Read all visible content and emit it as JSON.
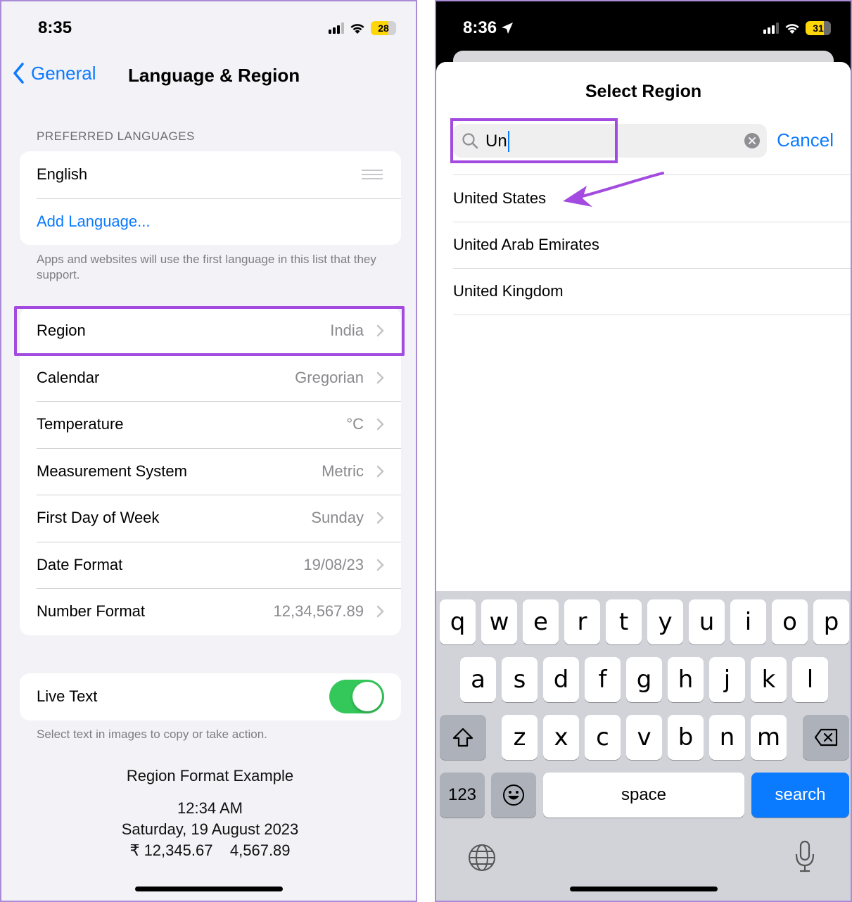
{
  "left_screen": {
    "status": {
      "time": "8:35",
      "battery": "28"
    },
    "nav": {
      "back_label": "General",
      "title": "Language & Region"
    },
    "preferred_languages": {
      "header": "PREFERRED LANGUAGES",
      "language": "English",
      "add_label": "Add Language...",
      "footer": "Apps and websites will use the first language in this list that they support."
    },
    "settings": [
      {
        "label": "Region",
        "value": "India"
      },
      {
        "label": "Calendar",
        "value": "Gregorian"
      },
      {
        "label": "Temperature",
        "value": "°C"
      },
      {
        "label": "Measurement System",
        "value": "Metric"
      },
      {
        "label": "First Day of Week",
        "value": "Sunday"
      },
      {
        "label": "Date Format",
        "value": "19/08/23"
      },
      {
        "label": "Number Format",
        "value": "12,34,567.89"
      }
    ],
    "live_text": {
      "label": "Live Text",
      "enabled": true,
      "footer": "Select text in images to copy or take action."
    },
    "example": {
      "title": "Region Format Example",
      "time": "12:34 AM",
      "date": "Saturday, 19 August 2023",
      "numbers": "₹ 12,345.67    4,567.89"
    }
  },
  "right_screen": {
    "status": {
      "time": "8:36",
      "battery": "31"
    },
    "sheet_title": "Select Region",
    "search": {
      "value": "Un",
      "cancel_label": "Cancel"
    },
    "results": [
      "United States",
      "United Arab Emirates",
      "United Kingdom"
    ],
    "keyboard": {
      "row1": [
        "q",
        "w",
        "e",
        "r",
        "t",
        "y",
        "u",
        "i",
        "o",
        "p"
      ],
      "row2": [
        "a",
        "s",
        "d",
        "f",
        "g",
        "h",
        "j",
        "k",
        "l"
      ],
      "row3": [
        "z",
        "x",
        "c",
        "v",
        "b",
        "n",
        "m"
      ],
      "numbers_label": "123",
      "space_label": "space",
      "search_label": "search"
    }
  },
  "colors": {
    "accent": "#0a7aff",
    "highlight": "#a34be0",
    "toggle_on": "#34c759"
  }
}
